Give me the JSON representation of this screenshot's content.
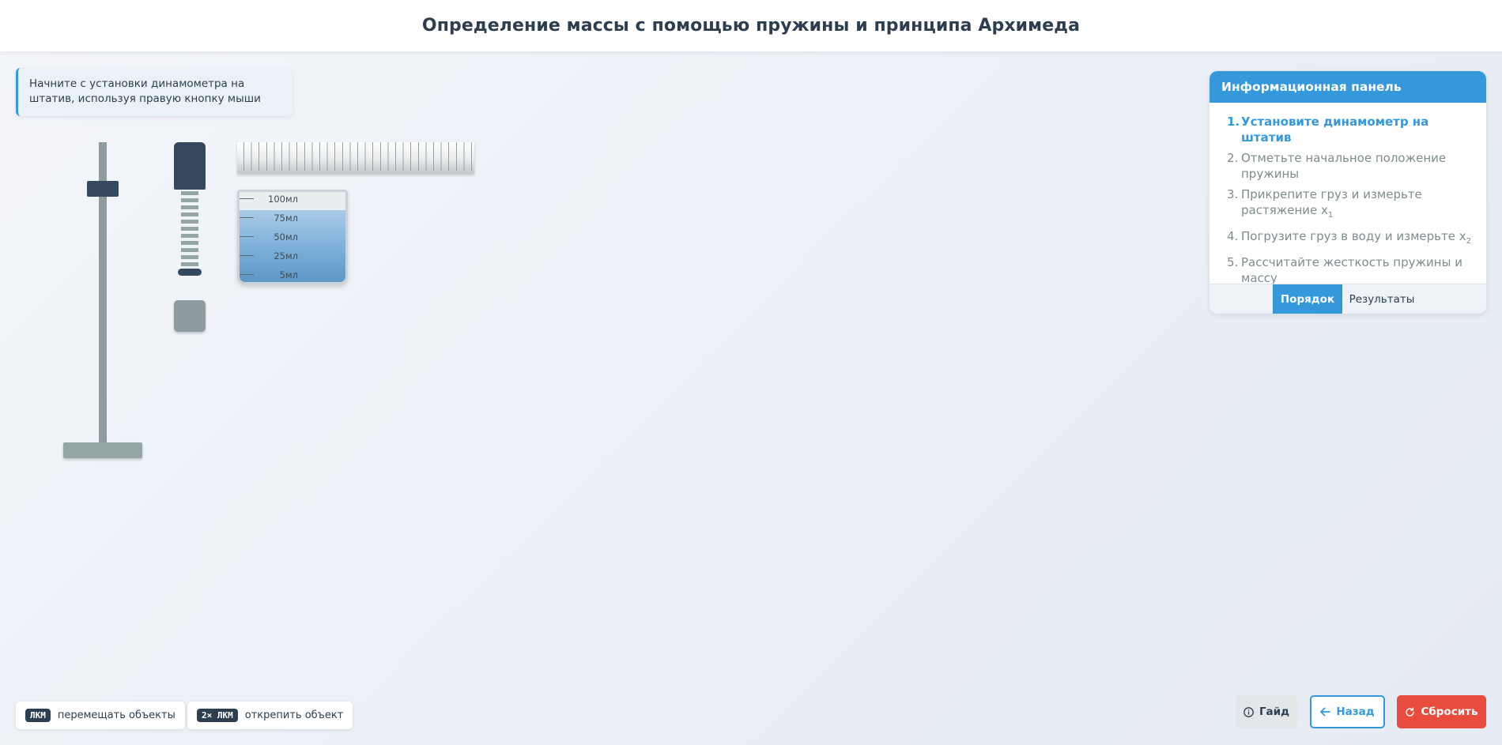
{
  "header": {
    "title": "Определение массы с помощью пружины и принципа Архимеда"
  },
  "hint": {
    "text": "Начните с установки динамометра на штатив, используя правую кнопку мыши"
  },
  "beaker": {
    "marks": [
      "100мл",
      "75мл",
      "50мл",
      "25мл",
      "5мл"
    ],
    "water_level_fraction": 0.8
  },
  "info_panel": {
    "title": "Информационная панель",
    "steps": [
      {
        "num": "1.",
        "text": "Установите динамометр на штатив",
        "active": true
      },
      {
        "num": "2.",
        "text": "Отметьте начальное положение пружины"
      },
      {
        "num": "3.",
        "text": "Прикрепите груз и измерьте растяжение x",
        "sub": "1"
      },
      {
        "num": "4.",
        "text": "Погрузите груз в воду и измерьте x",
        "sub": "2"
      },
      {
        "num": "5.",
        "text": "Рассчитайте жесткость пружины и массу"
      }
    ],
    "tabs": {
      "order": "Порядок",
      "results": "Результаты"
    }
  },
  "controls": [
    {
      "key": "ЛКМ",
      "text": "перемещать объекты"
    },
    {
      "key": "2× ЛКМ",
      "text": "открепить объект"
    }
  ],
  "buttons": {
    "guide": "Гайд",
    "back": "Назад",
    "reset": "Сбросить"
  },
  "colors": {
    "accent": "#3498db",
    "danger": "#e74c3c",
    "dark": "#2c3e50",
    "metal": "#95a5a6"
  }
}
